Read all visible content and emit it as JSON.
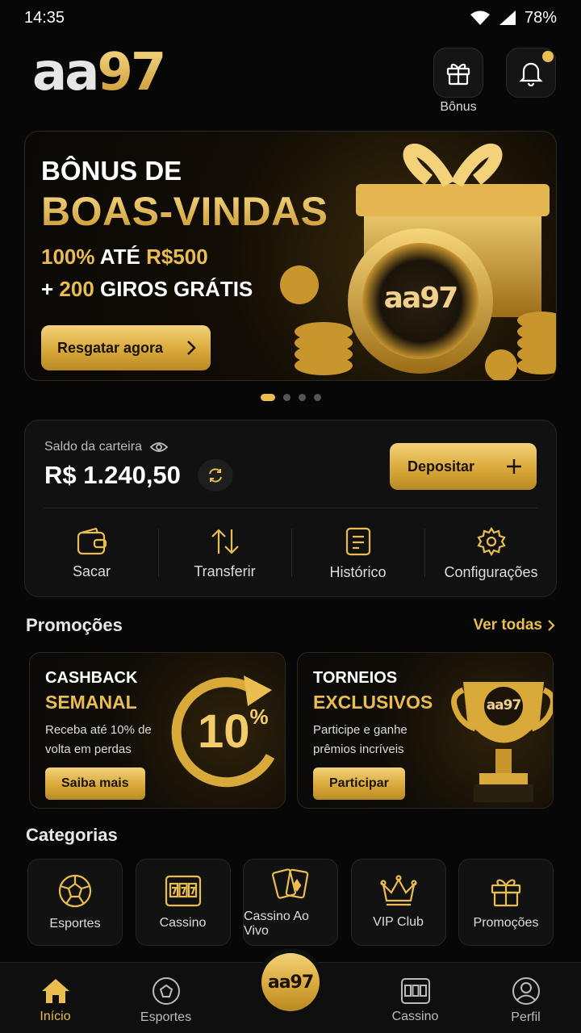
{
  "status": {
    "time": "14:35",
    "battery": "78%"
  },
  "header": {
    "logo_aa": "aa",
    "logo_97": "97",
    "bonus_label": "Bônus"
  },
  "banner": {
    "title_line1": "BÔNUS DE",
    "title_line2": "BOAS-VINDAS",
    "offer_pct": "100%",
    "offer_ate": " ATÉ ",
    "offer_amount": "R$500",
    "spins_plus": "+ ",
    "spins_count": "200",
    "spins_text": " GIROS GRÁTIS",
    "cta": "Resgatar agora",
    "chip_text": "aa97"
  },
  "wallet": {
    "label": "Saldo da carteira",
    "balance": "R$ 1.240,50",
    "deposit": "Depositar",
    "actions": [
      "Sacar",
      "Transferir",
      "Histórico",
      "Configurações"
    ]
  },
  "promotions": {
    "title": "Promoções",
    "see_all": "Ver todas",
    "cards": [
      {
        "line1": "CASHBACK",
        "line2": "SEMANAL",
        "desc": "Receba até 10% de volta em perdas",
        "cta": "Saiba mais",
        "badge": "10",
        "badge_pct": "%"
      },
      {
        "line1": "TORNEIOS",
        "line2": "EXCLUSIVOS",
        "desc": "Participe e ganhe prêmios incríveis",
        "cta": "Participar",
        "badge": "aa97"
      }
    ]
  },
  "categories": {
    "title": "Categorias",
    "items": [
      "Esportes",
      "Cassino",
      "Cassino Ao Vivo",
      "VIP Club",
      "Promoções"
    ]
  },
  "nav": {
    "items": [
      "Início",
      "Esportes",
      "Cassino",
      "Perfil"
    ],
    "center": "aa97"
  },
  "colors": {
    "accent": "#e9bd4f",
    "background": "#070707"
  }
}
